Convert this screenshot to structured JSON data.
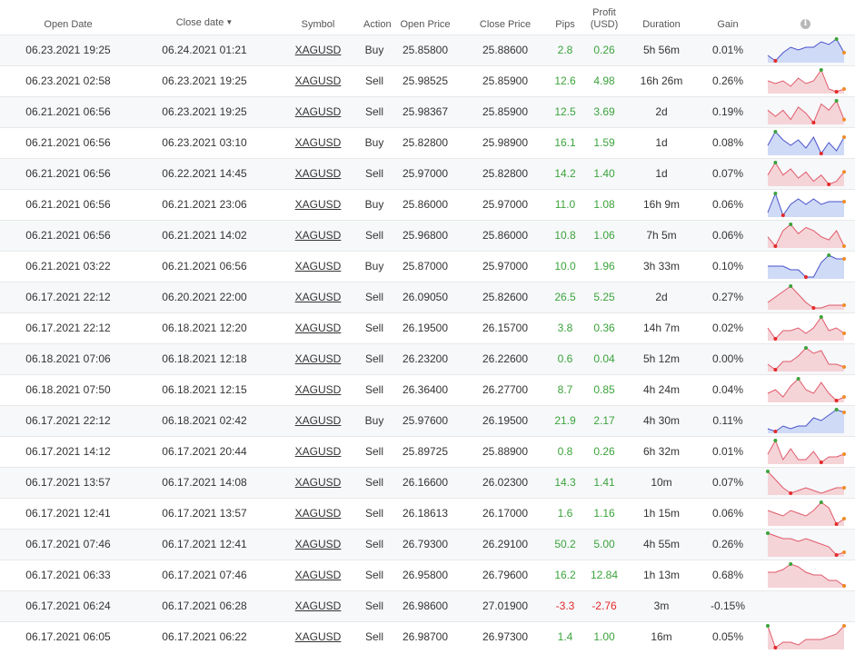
{
  "headers": {
    "open_date": "Open Date",
    "close_date": "Close date",
    "sort_arrow": "▼",
    "symbol": "Symbol",
    "action": "Action",
    "open_price": "Open Price",
    "close_price": "Close Price",
    "pips": "Pips",
    "profit_line1": "Profit",
    "profit_line2": "(USD)",
    "duration": "Duration",
    "gain": "Gain",
    "info_glyph": "i"
  },
  "colors": {
    "positive": "#3ca33c",
    "negative": "#e52929",
    "buy_line": "#4a52c9",
    "buy_fill": "#cfdaf7",
    "sell_line": "#e05a6a",
    "sell_fill": "#f5d4d8",
    "max_marker": "#3ca33c",
    "min_marker": "#e52929",
    "end_marker": "#f08c28"
  },
  "trades": [
    {
      "open_date": "06.23.2021 19:25",
      "close_date": "06.24.2021 01:21",
      "symbol": "XAGUSD",
      "action": "Buy",
      "open_price": "25.85800",
      "close_price": "25.88600",
      "pips": "2.8",
      "profit": "0.26",
      "duration": "5h 56m",
      "gain": "0.01%",
      "spark": [
        3,
        1,
        4,
        6,
        5,
        6,
        6,
        8,
        7,
        9,
        4
      ]
    },
    {
      "open_date": "06.23.2021 02:58",
      "close_date": "06.23.2021 19:25",
      "symbol": "XAGUSD",
      "action": "Sell",
      "open_price": "25.98525",
      "close_price": "25.85900",
      "pips": "12.6",
      "profit": "4.98",
      "duration": "16h 26m",
      "gain": "0.26%",
      "spark": [
        5,
        4,
        5,
        3,
        6,
        4,
        5,
        9,
        2,
        1,
        2
      ]
    },
    {
      "open_date": "06.21.2021 06:56",
      "close_date": "06.23.2021 19:25",
      "symbol": "XAGUSD",
      "action": "Sell",
      "open_price": "25.98367",
      "close_price": "25.85900",
      "pips": "12.5",
      "profit": "3.69",
      "duration": "2d",
      "gain": "0.19%",
      "spark": [
        6,
        4,
        6,
        3,
        7,
        5,
        2,
        8,
        6,
        9,
        3
      ]
    },
    {
      "open_date": "06.21.2021 06:56",
      "close_date": "06.23.2021 03:10",
      "symbol": "XAGUSD",
      "action": "Buy",
      "open_price": "25.82800",
      "close_price": "25.98900",
      "pips": "16.1",
      "profit": "1.59",
      "duration": "1d",
      "gain": "0.08%",
      "spark": [
        4,
        9,
        6,
        4,
        6,
        3,
        7,
        1,
        5,
        2,
        7
      ]
    },
    {
      "open_date": "06.21.2021 06:56",
      "close_date": "06.22.2021 14:45",
      "symbol": "XAGUSD",
      "action": "Sell",
      "open_price": "25.97000",
      "close_price": "25.82800",
      "pips": "14.2",
      "profit": "1.40",
      "duration": "1d",
      "gain": "0.07%",
      "spark": [
        5,
        9,
        5,
        7,
        4,
        6,
        3,
        5,
        2,
        3,
        6
      ]
    },
    {
      "open_date": "06.21.2021 06:56",
      "close_date": "06.21.2021 23:06",
      "symbol": "XAGUSD",
      "action": "Buy",
      "open_price": "25.86000",
      "close_price": "25.97000",
      "pips": "11.0",
      "profit": "1.08",
      "duration": "16h 9m",
      "gain": "0.06%",
      "spark": [
        2,
        9,
        1,
        5,
        7,
        5,
        7,
        5,
        6,
        6,
        6
      ]
    },
    {
      "open_date": "06.21.2021 06:56",
      "close_date": "06.21.2021 14:02",
      "symbol": "XAGUSD",
      "action": "Sell",
      "open_price": "25.96800",
      "close_price": "25.86000",
      "pips": "10.8",
      "profit": "1.06",
      "duration": "7h 5m",
      "gain": "0.06%",
      "spark": [
        5,
        2,
        7,
        9,
        6,
        8,
        7,
        5,
        4,
        7,
        2
      ]
    },
    {
      "open_date": "06.21.2021 03:22",
      "close_date": "06.21.2021 06:56",
      "symbol": "XAGUSD",
      "action": "Buy",
      "open_price": "25.87000",
      "close_price": "25.97000",
      "pips": "10.0",
      "profit": "1.96",
      "duration": "3h 33m",
      "gain": "0.10%",
      "spark": [
        6,
        6,
        6,
        5,
        5,
        3,
        3,
        7,
        9,
        8,
        8
      ]
    },
    {
      "open_date": "06.17.2021 22:12",
      "close_date": "06.20.2021 22:00",
      "symbol": "XAGUSD",
      "action": "Sell",
      "open_price": "26.09050",
      "close_price": "25.82600",
      "pips": "26.5",
      "profit": "5.25",
      "duration": "2d",
      "gain": "0.27%",
      "spark": [
        3,
        5,
        7,
        9,
        6,
        3,
        1,
        1,
        2,
        2,
        2
      ]
    },
    {
      "open_date": "06.17.2021 22:12",
      "close_date": "06.18.2021 12:20",
      "symbol": "XAGUSD",
      "action": "Sell",
      "open_price": "26.19500",
      "close_price": "26.15700",
      "pips": "3.8",
      "profit": "0.36",
      "duration": "14h 7m",
      "gain": "0.02%",
      "spark": [
        5,
        1,
        4,
        4,
        5,
        3,
        5,
        9,
        4,
        5,
        3
      ]
    },
    {
      "open_date": "06.18.2021 07:06",
      "close_date": "06.18.2021 12:18",
      "symbol": "XAGUSD",
      "action": "Sell",
      "open_price": "26.23200",
      "close_price": "26.22600",
      "pips": "0.6",
      "profit": "0.04",
      "duration": "5h 12m",
      "gain": "0.00%",
      "spark": [
        3,
        1,
        4,
        4,
        6,
        9,
        7,
        8,
        3,
        3,
        2
      ]
    },
    {
      "open_date": "06.18.2021 07:50",
      "close_date": "06.18.2021 12:15",
      "symbol": "XAGUSD",
      "action": "Sell",
      "open_price": "26.36400",
      "close_price": "26.27700",
      "pips": "8.7",
      "profit": "0.85",
      "duration": "4h 24m",
      "gain": "0.04%",
      "spark": [
        5,
        6,
        4,
        7,
        9,
        6,
        5,
        8,
        5,
        3,
        4
      ]
    },
    {
      "open_date": "06.17.2021 22:12",
      "close_date": "06.18.2021 02:42",
      "symbol": "XAGUSD",
      "action": "Buy",
      "open_price": "25.97600",
      "close_price": "26.19500",
      "pips": "21.9",
      "profit": "2.17",
      "duration": "4h 30m",
      "gain": "0.11%",
      "spark": [
        2,
        1,
        3,
        2,
        3,
        3,
        6,
        5,
        7,
        9,
        8
      ]
    },
    {
      "open_date": "06.17.2021 14:12",
      "close_date": "06.17.2021 20:44",
      "symbol": "XAGUSD",
      "action": "Sell",
      "open_price": "25.89725",
      "close_price": "25.88900",
      "pips": "0.8",
      "profit": "0.26",
      "duration": "6h 32m",
      "gain": "0.01%",
      "spark": [
        4,
        9,
        2,
        6,
        2,
        2,
        5,
        1,
        3,
        3,
        4
      ]
    },
    {
      "open_date": "06.17.2021 13:57",
      "close_date": "06.17.2021 14:08",
      "symbol": "XAGUSD",
      "action": "Sell",
      "open_price": "26.16600",
      "close_price": "26.02300",
      "pips": "14.3",
      "profit": "1.41",
      "duration": "10m",
      "gain": "0.07%",
      "spark": [
        9,
        6,
        3,
        1,
        2,
        3,
        2,
        1,
        2,
        3,
        3
      ]
    },
    {
      "open_date": "06.17.2021 12:41",
      "close_date": "06.17.2021 13:57",
      "symbol": "XAGUSD",
      "action": "Sell",
      "open_price": "26.18613",
      "close_price": "26.17000",
      "pips": "1.6",
      "profit": "1.16",
      "duration": "1h 15m",
      "gain": "0.06%",
      "spark": [
        6,
        5,
        4,
        6,
        5,
        4,
        6,
        9,
        7,
        1,
        3
      ]
    },
    {
      "open_date": "06.17.2021 07:46",
      "close_date": "06.17.2021 12:41",
      "symbol": "XAGUSD",
      "action": "Sell",
      "open_price": "26.79300",
      "close_price": "26.29100",
      "pips": "50.2",
      "profit": "5.00",
      "duration": "4h 55m",
      "gain": "0.26%",
      "spark": [
        9,
        8,
        7,
        7,
        6,
        7,
        6,
        5,
        4,
        1,
        2
      ]
    },
    {
      "open_date": "06.17.2021 06:33",
      "close_date": "06.17.2021 07:46",
      "symbol": "XAGUSD",
      "action": "Sell",
      "open_price": "26.95800",
      "close_price": "26.79600",
      "pips": "16.2",
      "profit": "12.84",
      "duration": "1h 13m",
      "gain": "0.68%",
      "spark": [
        6,
        6,
        7,
        9,
        8,
        6,
        5,
        5,
        3,
        3,
        1
      ]
    },
    {
      "open_date": "06.17.2021 06:24",
      "close_date": "06.17.2021 06:28",
      "symbol": "XAGUSD",
      "action": "Sell",
      "open_price": "26.98600",
      "close_price": "27.01900",
      "pips": "-3.3",
      "profit": "-2.76",
      "duration": "3m",
      "gain": "-0.15%",
      "spark": []
    },
    {
      "open_date": "06.17.2021 06:05",
      "close_date": "06.17.2021 06:22",
      "symbol": "XAGUSD",
      "action": "Sell",
      "open_price": "26.98700",
      "close_price": "26.97300",
      "pips": "1.4",
      "profit": "1.00",
      "duration": "16m",
      "gain": "0.05%",
      "spark": [
        9,
        1,
        3,
        3,
        2,
        4,
        4,
        4,
        5,
        6,
        9
      ]
    }
  ]
}
